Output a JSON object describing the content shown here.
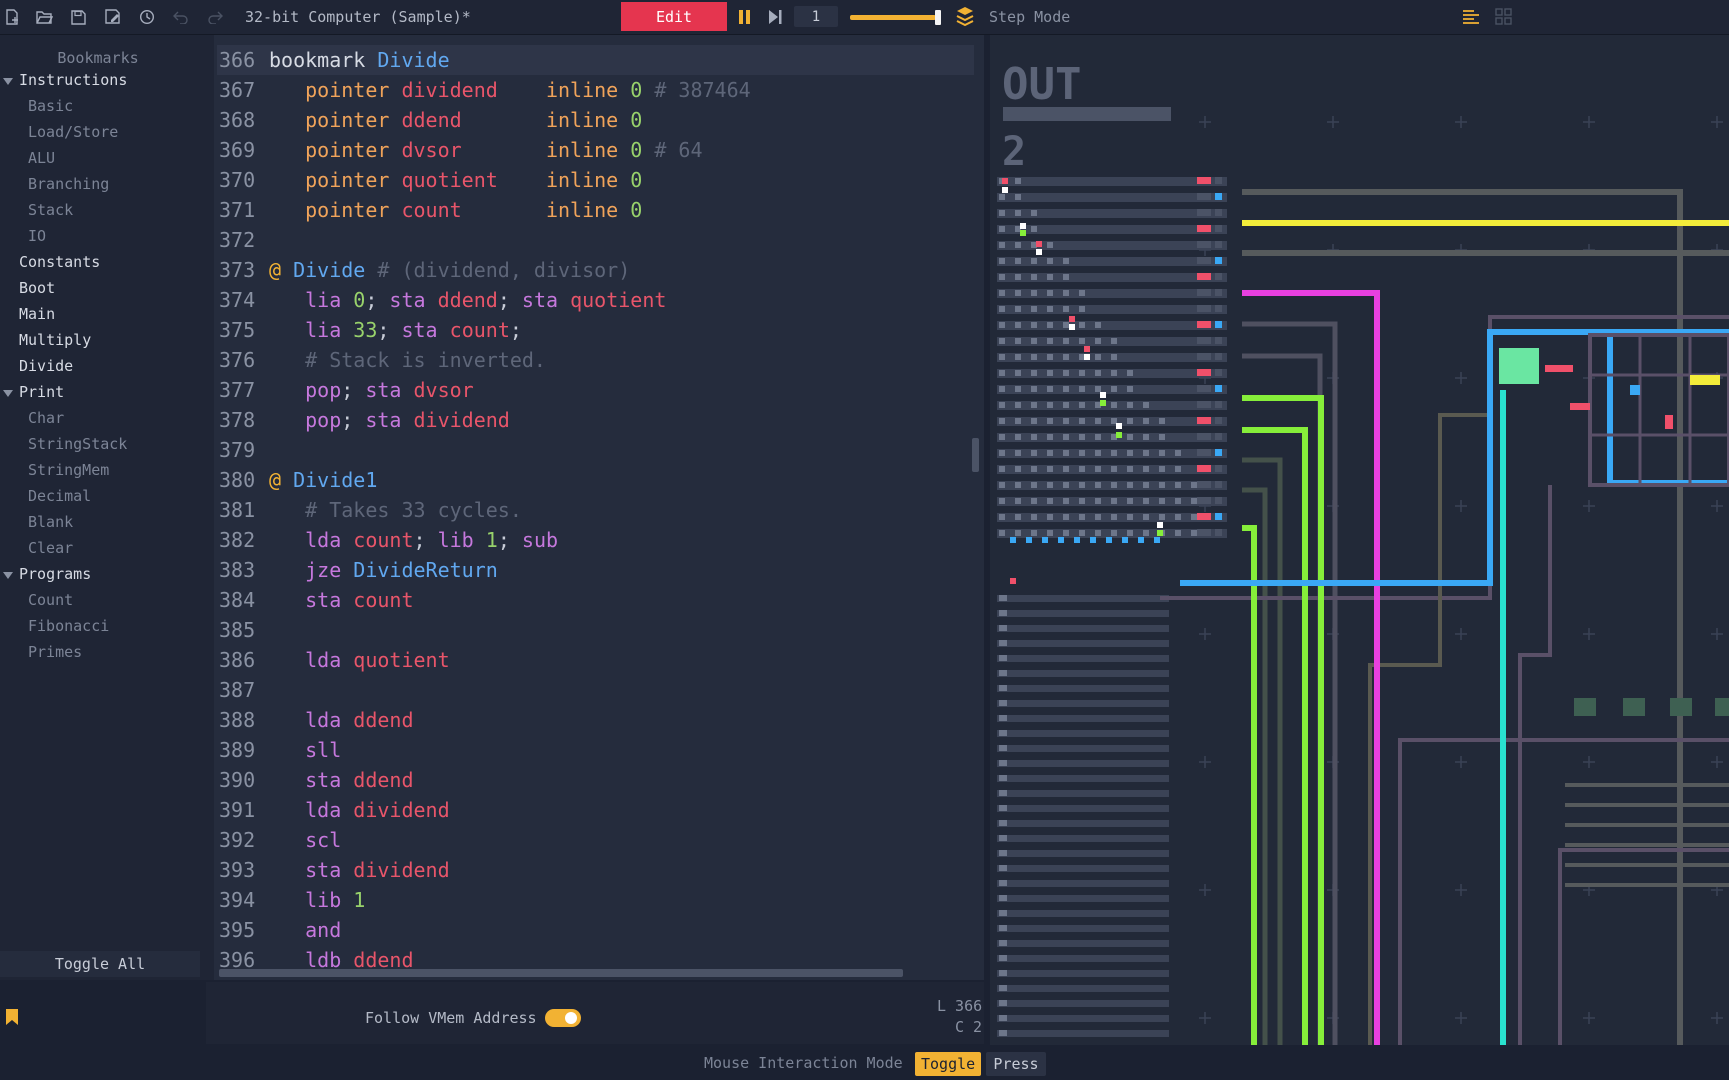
{
  "toolbar": {
    "title": "32-bit Computer (Sample)*",
    "edit_label": "Edit",
    "step_count": "1",
    "speed": 0.93,
    "step_mode_label": "Step Mode",
    "icons": [
      "new-file-icon",
      "open-folder-icon",
      "save-icon",
      "save-as-icon",
      "history-icon",
      "undo-icon",
      "redo-icon",
      "pause-icon",
      "step-icon",
      "layers-icon",
      "list-settings-icon",
      "grid-icon"
    ]
  },
  "sidebar": {
    "title": "Bookmarks",
    "items": [
      {
        "label": "Instructions",
        "kind": "group",
        "expanded": true
      },
      {
        "label": "Basic",
        "kind": "child"
      },
      {
        "label": "Load/Store",
        "kind": "child"
      },
      {
        "label": "ALU",
        "kind": "child"
      },
      {
        "label": "Branching",
        "kind": "child"
      },
      {
        "label": "Stack",
        "kind": "child"
      },
      {
        "label": "IO",
        "kind": "child"
      },
      {
        "label": "Constants",
        "kind": "group"
      },
      {
        "label": "Boot",
        "kind": "group"
      },
      {
        "label": "Main",
        "kind": "group"
      },
      {
        "label": "Multiply",
        "kind": "group"
      },
      {
        "label": "Divide",
        "kind": "group"
      },
      {
        "label": "Print",
        "kind": "group",
        "expanded": true
      },
      {
        "label": "Char",
        "kind": "child"
      },
      {
        "label": "StringStack",
        "kind": "child"
      },
      {
        "label": "StringMem",
        "kind": "child"
      },
      {
        "label": "Decimal",
        "kind": "child"
      },
      {
        "label": "Blank",
        "kind": "child"
      },
      {
        "label": "Clear",
        "kind": "child"
      },
      {
        "label": "Programs",
        "kind": "group",
        "expanded": true
      },
      {
        "label": "Count",
        "kind": "child"
      },
      {
        "label": "Fibonacci",
        "kind": "child"
      },
      {
        "label": "Primes",
        "kind": "child"
      }
    ],
    "toggle_all_label": "Toggle All"
  },
  "editor": {
    "lines": [
      {
        "n": "366",
        "tokens": [
          [
            "bmk",
            "bookmark "
          ],
          [
            "lbl",
            "Divide"
          ]
        ]
      },
      {
        "n": "367",
        "tokens": [
          [
            "",
            "   "
          ],
          [
            "kw2",
            "pointer "
          ],
          [
            "id",
            "dividend"
          ],
          [
            "",
            "    "
          ],
          [
            "kw2",
            "inline "
          ],
          [
            "nm",
            "0"
          ],
          [
            "cm",
            " # 387464"
          ]
        ]
      },
      {
        "n": "368",
        "tokens": [
          [
            "",
            "   "
          ],
          [
            "kw2",
            "pointer "
          ],
          [
            "id",
            "ddend"
          ],
          [
            "",
            "       "
          ],
          [
            "kw2",
            "inline "
          ],
          [
            "nm",
            "0"
          ]
        ]
      },
      {
        "n": "369",
        "tokens": [
          [
            "",
            "   "
          ],
          [
            "kw2",
            "pointer "
          ],
          [
            "id",
            "dvsor"
          ],
          [
            "",
            "       "
          ],
          [
            "kw2",
            "inline "
          ],
          [
            "nm",
            "0"
          ],
          [
            "cm",
            " # 64"
          ]
        ]
      },
      {
        "n": "370",
        "tokens": [
          [
            "",
            "   "
          ],
          [
            "kw2",
            "pointer "
          ],
          [
            "id",
            "quotient"
          ],
          [
            "",
            "    "
          ],
          [
            "kw2",
            "inline "
          ],
          [
            "nm",
            "0"
          ]
        ]
      },
      {
        "n": "371",
        "tokens": [
          [
            "",
            "   "
          ],
          [
            "kw2",
            "pointer "
          ],
          [
            "id",
            "count"
          ],
          [
            "",
            "       "
          ],
          [
            "kw2",
            "inline "
          ],
          [
            "nm",
            "0"
          ]
        ]
      },
      {
        "n": "372",
        "tokens": []
      },
      {
        "n": "373",
        "tokens": [
          [
            "at",
            "@ "
          ],
          [
            "lbl",
            "Divide"
          ],
          [
            "cm",
            " # (dividend, divisor)"
          ]
        ]
      },
      {
        "n": "374",
        "tokens": [
          [
            "",
            "   "
          ],
          [
            "kw",
            "lia "
          ],
          [
            "nm",
            "0"
          ],
          [
            "",
            ";"
          ],
          [
            "kw",
            " sta "
          ],
          [
            "id",
            "ddend"
          ],
          [
            "",
            ";"
          ],
          [
            "kw",
            " sta "
          ],
          [
            "id",
            "quotient"
          ]
        ]
      },
      {
        "n": "375",
        "tokens": [
          [
            "",
            "   "
          ],
          [
            "kw",
            "lia "
          ],
          [
            "nm",
            "33"
          ],
          [
            "",
            ";"
          ],
          [
            "kw",
            " sta "
          ],
          [
            "id",
            "count"
          ],
          [
            "",
            ";"
          ]
        ]
      },
      {
        "n": "376",
        "tokens": [
          [
            "",
            "   "
          ],
          [
            "cm",
            "# Stack is inverted."
          ]
        ]
      },
      {
        "n": "377",
        "tokens": [
          [
            "",
            "   "
          ],
          [
            "kw",
            "pop"
          ],
          [
            "",
            ";"
          ],
          [
            "kw",
            " sta "
          ],
          [
            "id",
            "dvsor"
          ]
        ]
      },
      {
        "n": "378",
        "tokens": [
          [
            "",
            "   "
          ],
          [
            "kw",
            "pop"
          ],
          [
            "",
            ";"
          ],
          [
            "kw",
            " sta "
          ],
          [
            "id",
            "dividend"
          ]
        ]
      },
      {
        "n": "379",
        "tokens": []
      },
      {
        "n": "380",
        "tokens": [
          [
            "at",
            "@ "
          ],
          [
            "lbl",
            "Divide1"
          ]
        ]
      },
      {
        "n": "381",
        "tokens": [
          [
            "",
            "   "
          ],
          [
            "cm",
            "# Takes 33 cycles."
          ]
        ]
      },
      {
        "n": "382",
        "tokens": [
          [
            "",
            "   "
          ],
          [
            "kw",
            "lda "
          ],
          [
            "id",
            "count"
          ],
          [
            "",
            ";"
          ],
          [
            "kw",
            " lib "
          ],
          [
            "nm",
            "1"
          ],
          [
            "",
            ";"
          ],
          [
            "kw",
            " sub"
          ]
        ]
      },
      {
        "n": "383",
        "tokens": [
          [
            "",
            "   "
          ],
          [
            "kw",
            "jze "
          ],
          [
            "lbl",
            "DivideReturn"
          ]
        ]
      },
      {
        "n": "384",
        "tokens": [
          [
            "",
            "   "
          ],
          [
            "kw",
            "sta "
          ],
          [
            "id",
            "count"
          ]
        ]
      },
      {
        "n": "385",
        "tokens": []
      },
      {
        "n": "386",
        "tokens": [
          [
            "",
            "   "
          ],
          [
            "kw",
            "lda "
          ],
          [
            "id",
            "quotient"
          ]
        ]
      },
      {
        "n": "387",
        "tokens": []
      },
      {
        "n": "388",
        "tokens": [
          [
            "",
            "   "
          ],
          [
            "kw",
            "lda "
          ],
          [
            "id",
            "ddend"
          ]
        ]
      },
      {
        "n": "389",
        "tokens": [
          [
            "",
            "   "
          ],
          [
            "kw",
            "sll"
          ]
        ]
      },
      {
        "n": "390",
        "tokens": [
          [
            "",
            "   "
          ],
          [
            "kw",
            "sta "
          ],
          [
            "id",
            "ddend"
          ]
        ]
      },
      {
        "n": "391",
        "tokens": [
          [
            "",
            "   "
          ],
          [
            "kw",
            "lda "
          ],
          [
            "id",
            "dividend"
          ]
        ]
      },
      {
        "n": "392",
        "tokens": [
          [
            "",
            "   "
          ],
          [
            "kw",
            "scl"
          ]
        ]
      },
      {
        "n": "393",
        "tokens": [
          [
            "",
            "   "
          ],
          [
            "kw",
            "sta "
          ],
          [
            "id",
            "dividend"
          ]
        ]
      },
      {
        "n": "394",
        "tokens": [
          [
            "",
            "   "
          ],
          [
            "kw",
            "lib "
          ],
          [
            "nm",
            "1"
          ]
        ]
      },
      {
        "n": "395",
        "tokens": [
          [
            "",
            "   "
          ],
          [
            "kw",
            "and"
          ]
        ]
      },
      {
        "n": "396",
        "tokens": [
          [
            "",
            "   "
          ],
          [
            "kw",
            "ldb "
          ],
          [
            "id",
            "ddend"
          ]
        ]
      }
    ],
    "follow_label": "Follow VMem Address",
    "follow_enabled": true,
    "line_pos": "L 366",
    "col_pos": "C 2"
  },
  "status": {
    "mim_label": "Mouse Interaction Mode",
    "toggle_label": "Toggle",
    "press_label": "Press"
  },
  "canvas": {
    "out_label": "OUT",
    "out_value": "2",
    "colors": {
      "bg": "#222938",
      "wire_dim": "#565a5c",
      "yellow": "#f3ec3a",
      "magenta": "#e840e0",
      "green": "#86ee3a",
      "blue": "#3aa8f5",
      "cyan": "#29e2cf",
      "red": "#f0506a"
    }
  }
}
